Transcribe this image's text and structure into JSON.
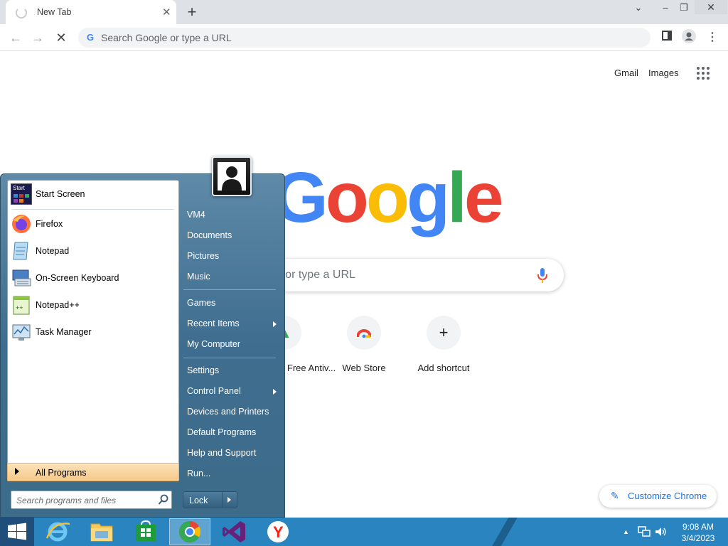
{
  "browser": {
    "tab_title": "New Tab",
    "omnibox_placeholder": "Search Google or type a URL"
  },
  "ntp": {
    "links": {
      "gmail": "Gmail",
      "images": "Images"
    },
    "logo_letters": [
      {
        "ch": "G",
        "color": "#4285f4"
      },
      {
        "ch": "o",
        "color": "#ea4335"
      },
      {
        "ch": "o",
        "color": "#fbbc05"
      },
      {
        "ch": "g",
        "color": "#4285f4"
      },
      {
        "ch": "l",
        "color": "#34a853"
      },
      {
        "ch": "e",
        "color": "#ea4335"
      }
    ],
    "search_placeholder": "Search Google or type a URL",
    "shortcuts": [
      {
        "label": "Avast Free Antiv...",
        "icon": "avast-icon"
      },
      {
        "label": "Web Store",
        "icon": "web-store-icon"
      },
      {
        "label": "Add shortcut",
        "icon": "plus-icon"
      }
    ],
    "customize_label": "Customize Chrome"
  },
  "start_menu": {
    "pinned": [
      {
        "label": "Start Screen",
        "icon": "start-screen-icon"
      },
      {
        "label": "Firefox",
        "icon": "firefox-icon"
      },
      {
        "label": "Notepad",
        "icon": "notepad-icon"
      },
      {
        "label": "On-Screen Keyboard",
        "icon": "keyboard-icon"
      },
      {
        "label": "Notepad++",
        "icon": "notepadpp-icon"
      },
      {
        "label": "Task Manager",
        "icon": "task-manager-icon"
      }
    ],
    "start_screen_badge": "Start",
    "all_programs": "All Programs",
    "search_placeholder": "Search programs and files",
    "right_items": {
      "user": "VM4",
      "documents": "Documents",
      "pictures": "Pictures",
      "music": "Music",
      "games": "Games",
      "recent_items": "Recent Items",
      "my_computer": "My Computer",
      "settings": "Settings",
      "control_panel": "Control Panel",
      "devices_printers": "Devices and Printers",
      "default_programs": "Default Programs",
      "help_support": "Help and Support",
      "run": "Run..."
    },
    "lock_label": "Lock"
  },
  "taskbar": {
    "apps": [
      {
        "name": "internet-explorer",
        "icon": "ie-icon"
      },
      {
        "name": "file-explorer",
        "icon": "folder-icon"
      },
      {
        "name": "store",
        "icon": "store-icon"
      },
      {
        "name": "chrome",
        "icon": "chrome-icon",
        "active": true
      },
      {
        "name": "visual-studio",
        "icon": "visual-studio-icon"
      },
      {
        "name": "yandex",
        "icon": "yandex-icon"
      }
    ],
    "clock_time": "9:08 AM",
    "clock_date": "3/4/2023"
  }
}
